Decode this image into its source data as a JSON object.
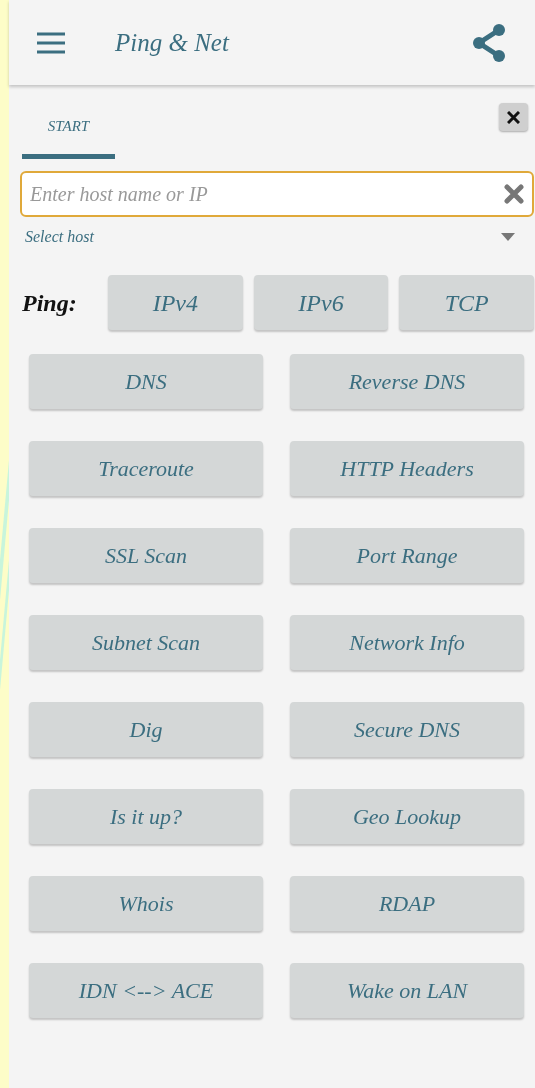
{
  "app_bar": {
    "title": "Ping & Net"
  },
  "tabs": [
    {
      "label": "START",
      "selected": true
    }
  ],
  "host_input": {
    "placeholder": "Enter host name or IP"
  },
  "host_select": {
    "label": "Select host"
  },
  "ping": {
    "label": "Ping:",
    "buttons": [
      "IPv4",
      "IPv6",
      "TCP"
    ]
  },
  "tools": [
    "DNS",
    "Reverse DNS",
    "Traceroute",
    "HTTP Headers",
    "SSL Scan",
    "Port Range",
    "Subnet Scan",
    "Network Info",
    "Dig",
    "Secure DNS",
    "Is it up?",
    "Geo Lookup",
    "Whois",
    "RDAP",
    "IDN <--> ACE",
    "Wake on LAN"
  ]
}
